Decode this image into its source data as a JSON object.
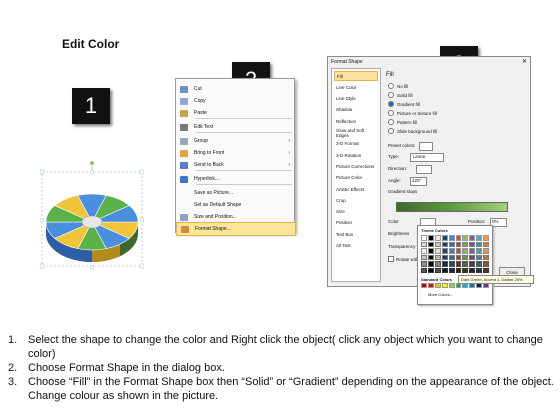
{
  "title": "Edit Color",
  "badges": [
    "1",
    "2",
    "3"
  ],
  "context_menu": {
    "items": [
      {
        "label": "Cut",
        "icon": "scissors-icon",
        "color": "#6b8fc9",
        "submenu": false
      },
      {
        "label": "Copy",
        "icon": "copy-icon",
        "color": "#8fa7cf",
        "submenu": false
      },
      {
        "label": "Paste",
        "icon": "paste-icon",
        "color": "#c9a24a",
        "submenu": false
      },
      {
        "label": "Edit Text",
        "icon": "edit-text-icon",
        "color": "#777777",
        "submenu": false
      },
      {
        "label": "Group",
        "icon": "group-icon",
        "color": "#9aa7b7",
        "submenu": true
      },
      {
        "label": "Bring to Front",
        "icon": "bring-to-front-icon",
        "color": "#e0a83a",
        "submenu": true
      },
      {
        "label": "Send to Back",
        "icon": "send-to-back-icon",
        "color": "#5a7fc0",
        "submenu": true
      },
      {
        "label": "Hyperlink...",
        "icon": "hyperlink-icon",
        "color": "#3a78c8",
        "submenu": false
      },
      {
        "label": "Save as Picture...",
        "icon": "",
        "color": "",
        "submenu": false
      },
      {
        "label": "Set as Default Shape",
        "icon": "",
        "color": "",
        "submenu": false
      },
      {
        "label": "Size and Position...",
        "icon": "size-position-icon",
        "color": "#8fa2c4",
        "submenu": false
      },
      {
        "label": "Format Shape...",
        "icon": "format-shape-icon",
        "color": "#d08a3a",
        "submenu": false
      }
    ],
    "highlighted": "Format Shape..."
  },
  "format_dialog": {
    "title": "Format Shape",
    "sidebar": [
      "Fill",
      "Line Color",
      "Line Style",
      "Shadow",
      "Reflection",
      "Glow and Soft Edges",
      "3-D Format",
      "3-D Rotation",
      "Picture Corrections",
      "Picture Color",
      "Artistic Effects",
      "Crop",
      "Size",
      "Position",
      "Text Box",
      "Alt Text"
    ],
    "selected": "Fill",
    "heading": "Fill",
    "radios": [
      "No fill",
      "Solid fill",
      "Gradient fill",
      "Picture or texture fill",
      "Pattern fill",
      "Slide background fill"
    ],
    "radio_selected": "Gradient fill",
    "preset_label": "Preset colors:",
    "type_label": "Type:",
    "type_value": "Linear",
    "direction_label": "Direction:",
    "angle_label": "Angle:",
    "angle_value": "220°",
    "gradient_stops_label": "Gradient stops",
    "color_label": "Color",
    "position_label": "Position:",
    "position_value": "0%",
    "brightness_label": "Brightness",
    "transparency_label": "Transparency",
    "rotate_label": "Rotate with shape",
    "close_label": "Close"
  },
  "color_picker": {
    "theme_heading": "Theme Colors",
    "standard_heading": "Standard Colors",
    "more_label": "More Colors...",
    "tooltip": "Dark Green, Accent 1, Darker 25%"
  },
  "steps": [
    "Select the shape to change the color and Right click the object( click any object which you want to change color)",
    "Choose Format Shape in the dialog box.",
    "Choose “Fill” in the Format Shape box then “Solid” or “Gradient” depending on the appearance of the object. Change colour as shown in the picture."
  ]
}
